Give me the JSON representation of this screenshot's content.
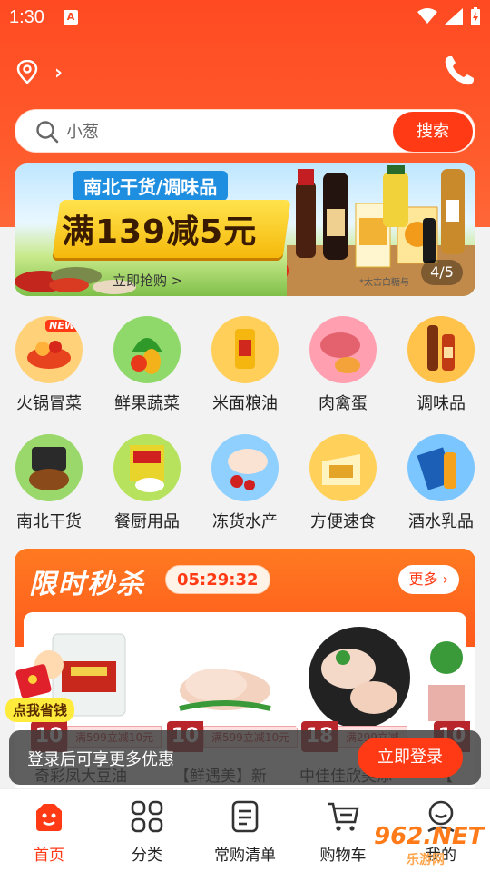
{
  "status_bar": {
    "time": "1:30",
    "app_icon_letter": "A"
  },
  "header": {
    "search_placeholder": "小葱",
    "search_button": "搜索"
  },
  "banner": {
    "tag": "南北干货/调味品",
    "promo": "满139减5元",
    "cta": "立即抢购 >",
    "fine_print": "*太古白糖与",
    "pager": "4/5"
  },
  "categories": [
    {
      "label": "火锅冒菜",
      "icon": "hotpot-icon",
      "color": "#ffd27a",
      "badge": "NEW"
    },
    {
      "label": "鲜果蔬菜",
      "icon": "vegetables-icon",
      "color": "#8fd96a"
    },
    {
      "label": "米面粮油",
      "icon": "oil-icon",
      "color": "#ffcf5a"
    },
    {
      "label": "肉禽蛋",
      "icon": "meat-icon",
      "color": "#ff9fb0"
    },
    {
      "label": "调味品",
      "icon": "sauce-icon",
      "color": "#ffc24a"
    },
    {
      "label": "南北干货",
      "icon": "dried-goods-icon",
      "color": "#9bd86b"
    },
    {
      "label": "餐厨用品",
      "icon": "kitchenware-icon",
      "color": "#b7e25e"
    },
    {
      "label": "冻货水产",
      "icon": "frozen-icon",
      "color": "#8fd0ff"
    },
    {
      "label": "方便速食",
      "icon": "instant-food-icon",
      "color": "#ffd05a"
    },
    {
      "label": "酒水乳品",
      "icon": "drinks-icon",
      "color": "#7cc6ff"
    }
  ],
  "flash_sale": {
    "title": "限时秒杀",
    "timer": "05:29:32",
    "more": "更多 ›",
    "products": [
      {
        "name": "奇彩凤大豆油",
        "tag_num": "10",
        "tag_text": "满599立减10元"
      },
      {
        "name": "【鲜遇美】新",
        "tag_num": "10",
        "tag_text": "满599立减10元"
      },
      {
        "name": "中佳佳欣美添",
        "tag_num": "18",
        "tag_text": "满299立减"
      },
      {
        "name": "【",
        "tag_num": "10",
        "tag_text": ""
      }
    ]
  },
  "save_badge": "点我省钱",
  "login_bar": {
    "message": "登录后可享更多优惠",
    "button": "立即登录"
  },
  "tabbar": [
    {
      "label": "首页",
      "active": true
    },
    {
      "label": "分类"
    },
    {
      "label": "常购清单"
    },
    {
      "label": "购物车"
    },
    {
      "label": "我的"
    }
  ],
  "watermark": {
    "big": "962.NET",
    "small": "乐游网"
  },
  "colors": {
    "brand": "#ff3a14",
    "hero": "#ff4a22"
  }
}
